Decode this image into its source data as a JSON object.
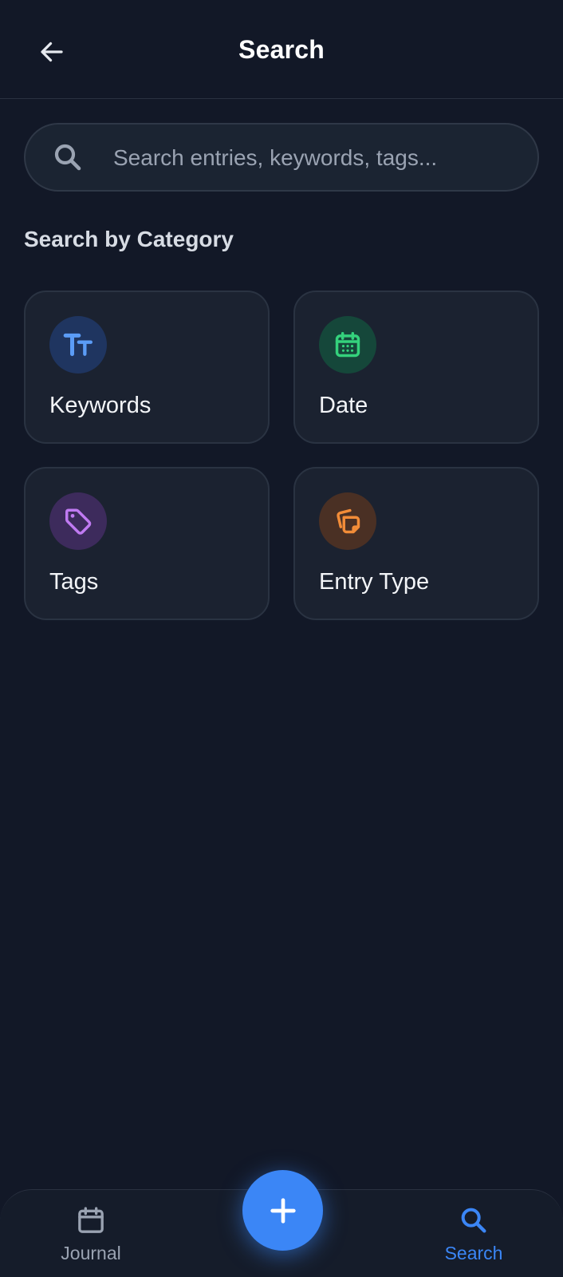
{
  "header": {
    "title": "Search",
    "back_icon": "arrow-left-icon"
  },
  "search": {
    "placeholder": "Search entries, keywords, tags...",
    "value": "",
    "icon": "search-icon"
  },
  "category_section": {
    "title": "Search by Category",
    "items": [
      {
        "label": "Keywords",
        "icon": "text-size-icon",
        "accent": "#5b9cf6",
        "badge_bg": "#1f3560"
      },
      {
        "label": "Date",
        "icon": "calendar-icon",
        "accent": "#34d27c",
        "badge_bg": "#15473a"
      },
      {
        "label": "Tags",
        "icon": "tag-icon",
        "accent": "#c07af2",
        "badge_bg": "#3d2b5c"
      },
      {
        "label": "Entry Type",
        "icon": "copy-icon",
        "accent": "#f28c38",
        "badge_bg": "#4a3024"
      }
    ]
  },
  "bottom_nav": {
    "items": [
      {
        "label": "Journal",
        "icon": "calendar-icon",
        "active": false,
        "color": "#9aa3b2"
      },
      {
        "label": "Search",
        "icon": "search-icon",
        "active": true,
        "color": "#3b86f6"
      }
    ],
    "fab_icon": "plus-icon",
    "fab_color": "#3b86f6"
  }
}
